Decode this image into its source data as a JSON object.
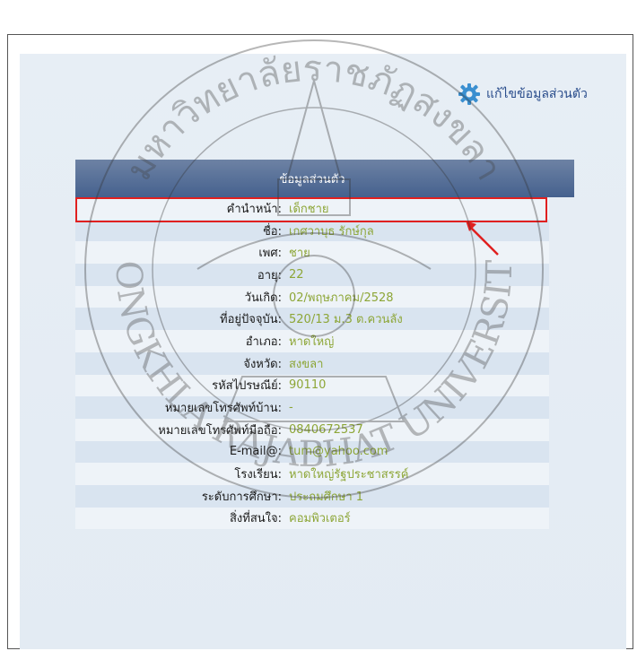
{
  "header": {
    "edit_label": "แก้ไขข้อมูลส่วนตัว",
    "edit_icon": "gear-icon"
  },
  "table": {
    "title": "ข้อมูลส่วนตัว",
    "rows": [
      {
        "label": "คำนำหน้า:",
        "value": "เด็กชาย"
      },
      {
        "label": "ชื่อ:",
        "value": "เกศวาบุธ รักษ์กุล"
      },
      {
        "label": "เพศ:",
        "value": "ชาย"
      },
      {
        "label": "อายุ:",
        "value": "22"
      },
      {
        "label": "วันเกิด:",
        "value": "02/พฤษภาคม/2528"
      },
      {
        "label": "ที่อยู่ปัจจุบัน:",
        "value": "520/13 ม.3 ต.ควนลัง"
      },
      {
        "label": "อำเภอ:",
        "value": "หาดใหญ่"
      },
      {
        "label": "จังหวัด:",
        "value": "สงขลา"
      },
      {
        "label": "รหัสไปรษณีย์:",
        "value": "90110"
      },
      {
        "label": "หมายเลขโทรศัพท์บ้าน:",
        "value": "-"
      },
      {
        "label": "หมายเลขโทรศัพท์มือถือ:",
        "value": "0840672537"
      },
      {
        "label": "E-mail@:",
        "value": "tum@yahoo.com"
      },
      {
        "label": "โรงเรียน:",
        "value": "หาดใหญ่รัฐประชาสรรค์"
      },
      {
        "label": "ระดับการศึกษา:",
        "value": "ประถมศึกษา 1"
      },
      {
        "label": "สิ่งที่สนใจ:",
        "value": "คอมพิวเตอร์"
      }
    ]
  },
  "watermark": {
    "top": "มหาวิทยาลัยราชภัฏสงขลา",
    "bottom": "SONGKHLA RAJABHAT UNIVERSITY"
  },
  "colors": {
    "header_bg": "#45618e",
    "value_text": "#8da637",
    "highlight": "#e02020",
    "link": "#2a4d8c"
  }
}
